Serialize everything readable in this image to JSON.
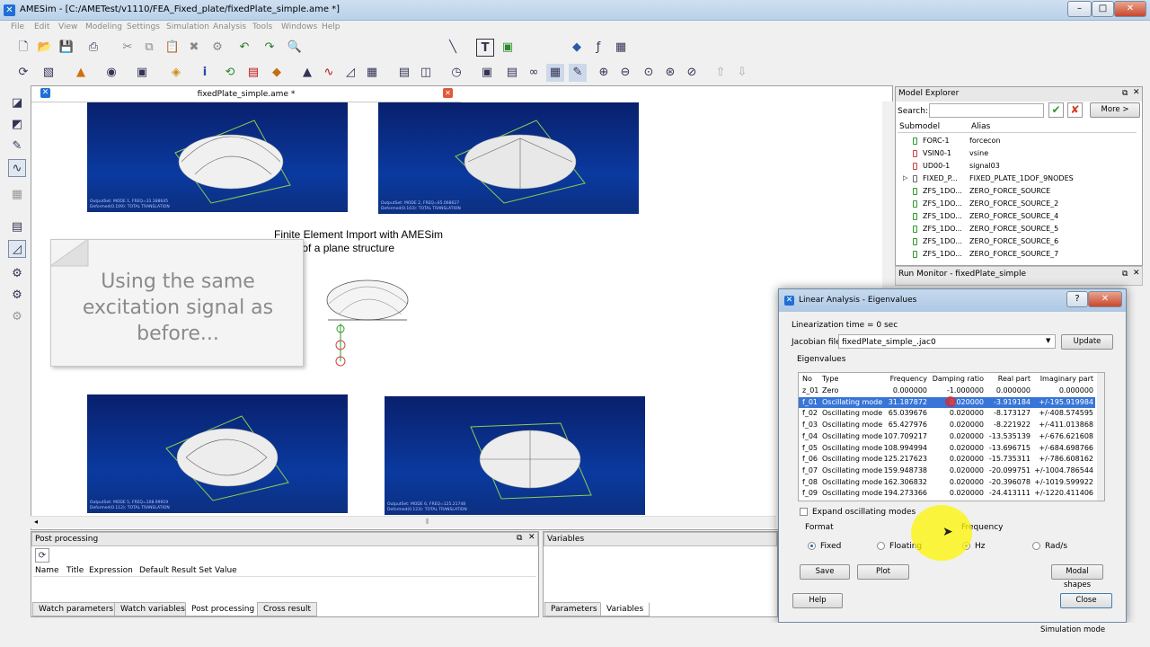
{
  "window": {
    "title": "AMESim - [C:/AMETest/v1110/FEA_Fixed_plate/fixedPlate_simple.ame *]",
    "icon": "app-icon"
  },
  "menu": [
    "File",
    "Edit",
    "View",
    "Modeling",
    "Settings",
    "Simulation",
    "Analysis",
    "Tools",
    "Windows",
    "Help"
  ],
  "document": {
    "tab_title": "fixedPlate_simple.ame *",
    "heading": "Finite Element Import with AMESim",
    "subheading": "Case of a plane structure",
    "sim_images": [
      {
        "caption1": "OutputSet: MODE 1, FREQ=31.188645",
        "caption2": "Deformed(0.109): TOTAL TRANSLATION"
      },
      {
        "caption1": "OutputSet: MODE 2, FREQ=65.068627",
        "caption2": "Deformed(0.103): TOTAL TRANSLATION"
      },
      {
        "caption1": "OutputSet: MODE 5, FREQ=108.99919",
        "caption2": "Deformed(0.112): TOTAL TRANSLATION"
      },
      {
        "caption1": "OutputSet: MODE 6, FREQ=125.21748",
        "caption2": "Deformed(0.123): TOTAL TRANSLATION"
      }
    ]
  },
  "callout": "Using the same excitation signal as before...",
  "post_processing": {
    "title": "Post processing",
    "columns": [
      "Name",
      "Title",
      "Expression",
      "Default Result Set",
      "Value"
    ]
  },
  "variables_panel": {
    "title": "Variables"
  },
  "bottom_tabs_left": [
    "Watch parameters",
    "Watch variables",
    "Post processing",
    "Cross result"
  ],
  "bottom_tabs_right": [
    "Parameters",
    "Variables"
  ],
  "model_explorer": {
    "title": "Model Explorer",
    "search_label": "Search:",
    "more_button": "More >",
    "columns": [
      "Submodel",
      "Alias"
    ],
    "rows": [
      {
        "submodel": "FORC-1",
        "alias": "forcecon"
      },
      {
        "submodel": "VSIN0-1",
        "alias": "vsine"
      },
      {
        "submodel": "UD00-1",
        "alias": "signal03"
      },
      {
        "submodel": "FIXED_P...",
        "alias": "FIXED_PLATE_1DOF_9NODES"
      },
      {
        "submodel": "ZFS_1DO...",
        "alias": "ZERO_FORCE_SOURCE"
      },
      {
        "submodel": "ZFS_1DO...",
        "alias": "ZERO_FORCE_SOURCE_2"
      },
      {
        "submodel": "ZFS_1DO...",
        "alias": "ZERO_FORCE_SOURCE_4"
      },
      {
        "submodel": "ZFS_1DO...",
        "alias": "ZERO_FORCE_SOURCE_5"
      },
      {
        "submodel": "ZFS_1DO...",
        "alias": "ZERO_FORCE_SOURCE_6"
      },
      {
        "submodel": "ZFS_1DO...",
        "alias": "ZERO_FORCE_SOURCE_7"
      }
    ]
  },
  "run_monitor": {
    "title": "Run Monitor - fixedPlate_simple"
  },
  "dialog": {
    "title": "Linear Analysis - Eigenvalues",
    "linearization_time": "Linearization time = 0 sec",
    "jacobian_label": "Jacobian file",
    "jacobian_value": "fixedPlate_simple_.jac0",
    "update_button": "Update",
    "eigenvalues_label": "Eigenvalues",
    "columns": [
      "No",
      "Type",
      "Frequency",
      "Damping ratio",
      "Real part",
      "Imaginary part"
    ],
    "rows": [
      [
        "z_01",
        "Zero",
        "0.000000",
        "-1.000000",
        "0.000000",
        "0.000000"
      ],
      [
        "f_01",
        "Oscillating mode",
        "31.187872",
        "0.020000",
        "-3.919184",
        "+/-195.919984"
      ],
      [
        "f_02",
        "Oscillating mode",
        "65.039676",
        "0.020000",
        "-8.173127",
        "+/-408.574595"
      ],
      [
        "f_03",
        "Oscillating mode",
        "65.427976",
        "0.020000",
        "-8.221922",
        "+/-411.013868"
      ],
      [
        "f_04",
        "Oscillating mode",
        "107.709217",
        "0.020000",
        "-13.535139",
        "+/-676.621608"
      ],
      [
        "f_05",
        "Oscillating mode",
        "108.994994",
        "0.020000",
        "-13.696715",
        "+/-684.698766"
      ],
      [
        "f_06",
        "Oscillating mode",
        "125.217623",
        "0.020000",
        "-15.735311",
        "+/-786.608162"
      ],
      [
        "f_07",
        "Oscillating mode",
        "159.948738",
        "0.020000",
        "-20.099751",
        "+/-1004.786544"
      ],
      [
        "f_08",
        "Oscillating mode",
        "162.306832",
        "0.020000",
        "-20.396078",
        "+/-1019.599922"
      ],
      [
        "f_09",
        "Oscillating mode",
        "194.273366",
        "0.020000",
        "-24.413111",
        "+/-1220.411406"
      ]
    ],
    "expand_label": "Expand oscillating modes",
    "format_label": "Format",
    "fixed_label": "Fixed",
    "floating_label": "Floating",
    "frequency_label": "Frequency",
    "hz_label": "Hz",
    "rads_label": "Rad/s",
    "save_button": "Save",
    "plot_button": "Plot",
    "modal_button": "Modal shapes",
    "help_button": "Help",
    "close_button": "Close"
  },
  "status": {
    "mode": "Simulation mode"
  }
}
